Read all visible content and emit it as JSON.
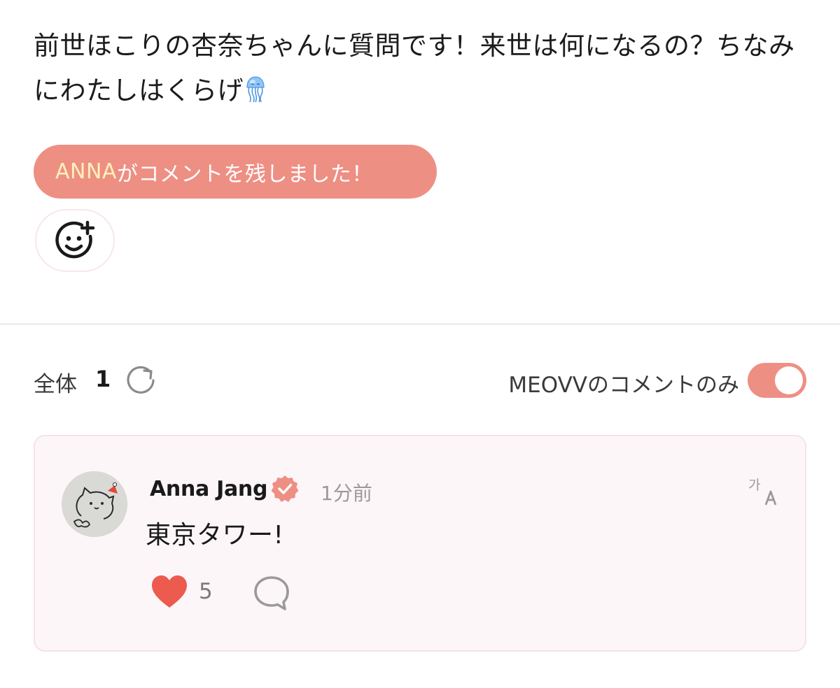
{
  "post": {
    "text": "前世ほこりの杏奈ちゃんに質問です！来世は何になるの？ちなみにわたしはくらげ",
    "emoji": "jellyfish-emoji"
  },
  "banner": {
    "author": "ANNA",
    "message": "がコメントを残しました！"
  },
  "reaction": {
    "icon": "add-reaction-smiley-icon"
  },
  "comments_header": {
    "total_label": "全体",
    "total_count": "1",
    "refresh_icon": "refresh-icon",
    "filter_label": "MEOVVのコメントのみ",
    "filter_enabled": true
  },
  "comment": {
    "author": "Anna Jang",
    "verified_icon": "verified-badge-icon",
    "time": "1分前",
    "body": "東京タワー!",
    "likes": "5",
    "translate_icon": "translate-icon",
    "reply_icon": "reply-bubble-icon"
  },
  "colors": {
    "accent": "#ee8f84",
    "banner_author": "#fff1b8",
    "card_bg": "#fdf6f8",
    "card_border": "#f6e2ea",
    "heart": "#ec5b4e"
  }
}
